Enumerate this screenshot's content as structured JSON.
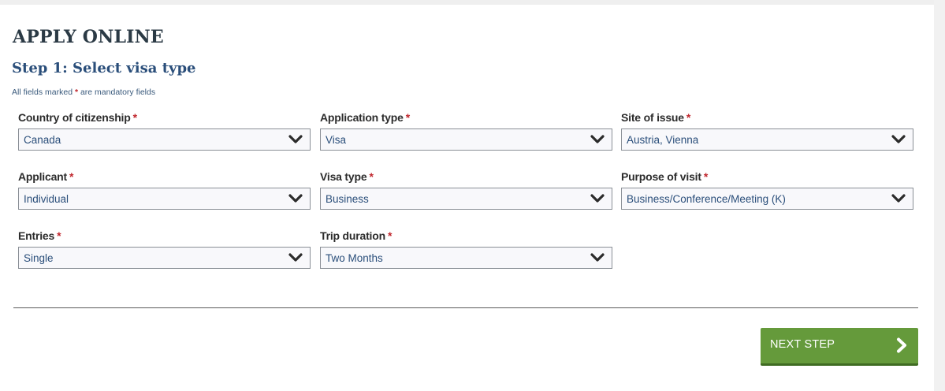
{
  "header": {
    "title": "APPLY ONLINE",
    "step_title": "Step 1: Select visa type",
    "note_before": "All fields marked",
    "note_marker": "*",
    "note_after": "are mandatory fields"
  },
  "required_marker": "*",
  "fields": [
    {
      "label": "Country of citizenship",
      "value": "Canada"
    },
    {
      "label": "Application type",
      "value": "Visa"
    },
    {
      "label": "Site of issue",
      "value": "Austria, Vienna"
    },
    {
      "label": "Applicant",
      "value": "Individual"
    },
    {
      "label": "Visa type",
      "value": "Business"
    },
    {
      "label": "Purpose of visit",
      "value": "Business/Conference/Meeting (K)"
    },
    {
      "label": "Entries",
      "value": "Single"
    },
    {
      "label": "Trip duration",
      "value": "Two Months"
    }
  ],
  "actions": {
    "next_label": "NEXT STEP"
  },
  "colors": {
    "accent_green": "#659a3b",
    "required_red": "#c0262d",
    "value_blue": "#2a4e7a"
  },
  "icons": {
    "select_toggle": "chevron-down-icon",
    "next": "chevron-right-icon"
  }
}
